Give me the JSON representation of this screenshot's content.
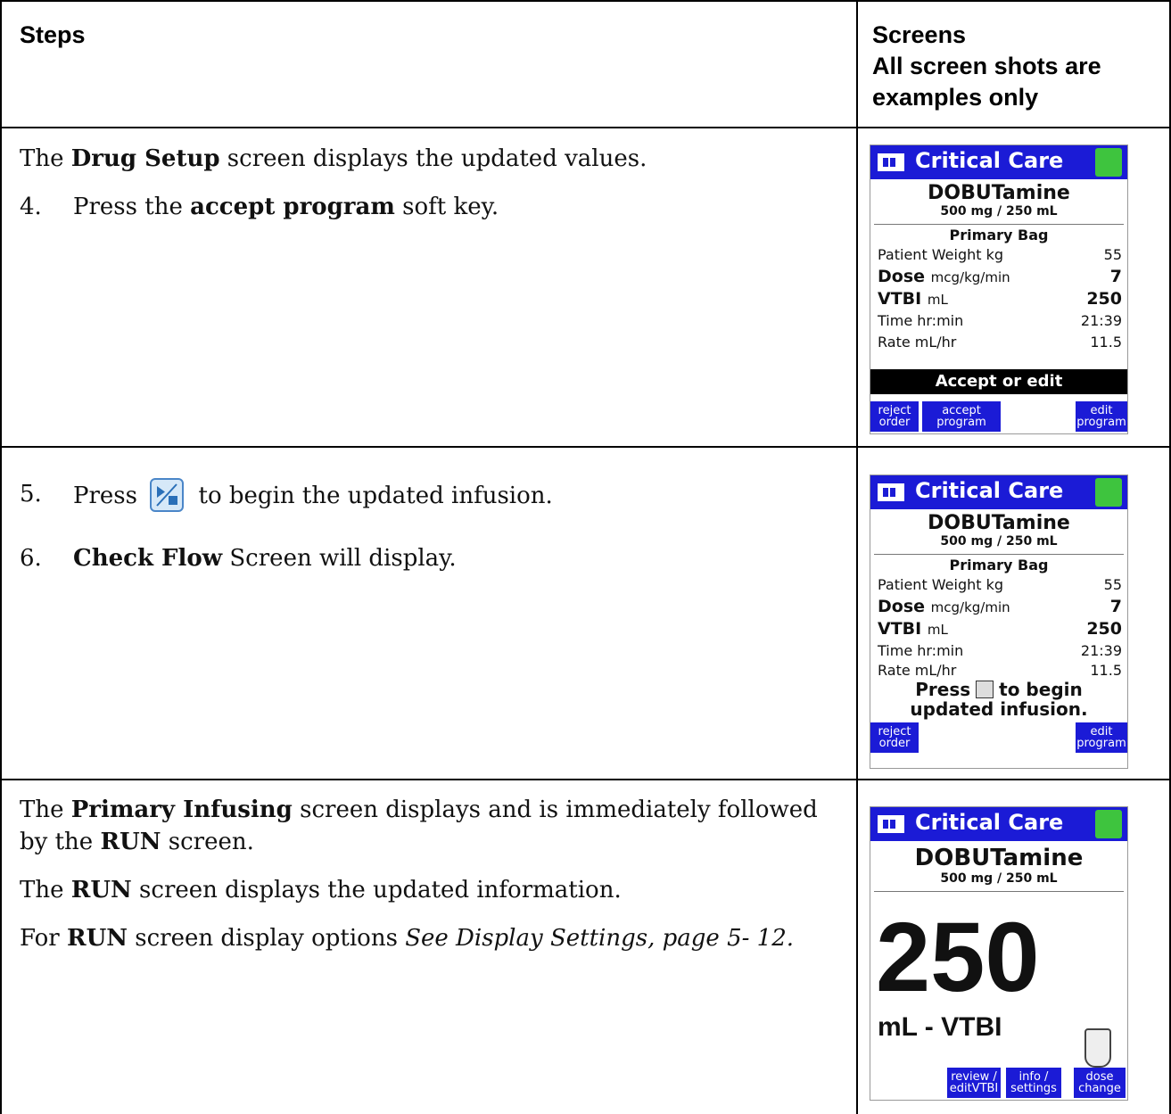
{
  "header": {
    "steps": "Steps",
    "screens_line1": "Screens",
    "screens_line2": "All screen shots are",
    "screens_line3": "examples only"
  },
  "row1": {
    "p1_pre": "The ",
    "p1_bold": "Drug Setup",
    "p1_post": " screen displays the updated values.",
    "step_num": "4.",
    "step_pre": "Press the ",
    "step_bold": "accept program",
    "step_post": " soft key."
  },
  "row2": {
    "step5_num": "5.",
    "step5_pre": "Press",
    "step5_post": "to begin the updated infusion.",
    "step6_num": "6.",
    "step6_bold": "Check Flow",
    "step6_post": " Screen will display."
  },
  "row3": {
    "p1_pre": "The ",
    "p1_bold": "Primary Infusing",
    "p1_post": " screen displays and is immediately followed",
    "p1_line2_pre": "by the ",
    "p1_line2_bold": "RUN",
    "p1_line2_post": " screen.",
    "p2_pre": "The ",
    "p2_bold": "RUN",
    "p2_post": " screen displays the updated information.",
    "p3_pre": "For ",
    "p3_bold": "RUN",
    "p3_mid": " screen display options ",
    "p3_italic": "See Display Settings, page 5- 12."
  },
  "screen_common": {
    "title": "Critical Care",
    "drug": "DOBUTamine",
    "concentration": "500 mg / 250 mL",
    "bag": "Primary Bag",
    "rows": [
      {
        "label": "Patient Weight kg",
        "value": "55"
      },
      {
        "label_bold": "Dose",
        "label_unit": "mcg/kg/min",
        "value": "7"
      },
      {
        "label_bold": "VTBI",
        "label_unit": "mL",
        "value": "250"
      },
      {
        "label": "Time hr:min",
        "value": "21:39"
      },
      {
        "label": "Rate mL/hr",
        "value": "11.5"
      }
    ]
  },
  "screen1": {
    "message": "Accept or edit",
    "key_reject_1": "reject",
    "key_reject_2": "order",
    "key_accept_1": "accept",
    "key_accept_2": "program",
    "key_edit_1": "edit",
    "key_edit_2": "program"
  },
  "screen2": {
    "press_pre": "Press",
    "press_post": "to begin",
    "press_line2": "updated infusion.",
    "key_reject_1": "reject",
    "key_reject_2": "order",
    "key_edit_1": "edit",
    "key_edit_2": "program"
  },
  "screen3": {
    "big_value": "250",
    "unit": "mL - VTBI",
    "key_review_1": "review /",
    "key_review_2": "editVTBI",
    "key_info_1": "info /",
    "key_info_2": "settings",
    "key_dose_1": "dose",
    "key_dose_2": "change"
  },
  "colors": {
    "title_bar": "#1b1bd6",
    "signal": "#3ec43e",
    "icon_border": "#4a86c8"
  }
}
